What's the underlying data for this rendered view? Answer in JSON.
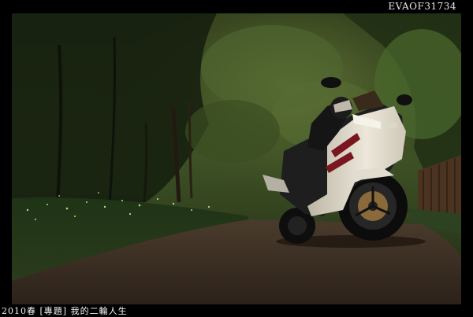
{
  "watermark": "EVAOF31734",
  "caption": "2010春 [專題] 我的二輪人生",
  "scene": {
    "subject": "motorcycle-rider-icon",
    "colors": {
      "border": "#000000",
      "forest_dark": "#1a2412",
      "forest_mid": "#3d5226",
      "forest_light": "#6a7b3a",
      "road": "#3b2f25",
      "fairing": "#e6e1d4",
      "stripe": "#7a1620"
    }
  }
}
